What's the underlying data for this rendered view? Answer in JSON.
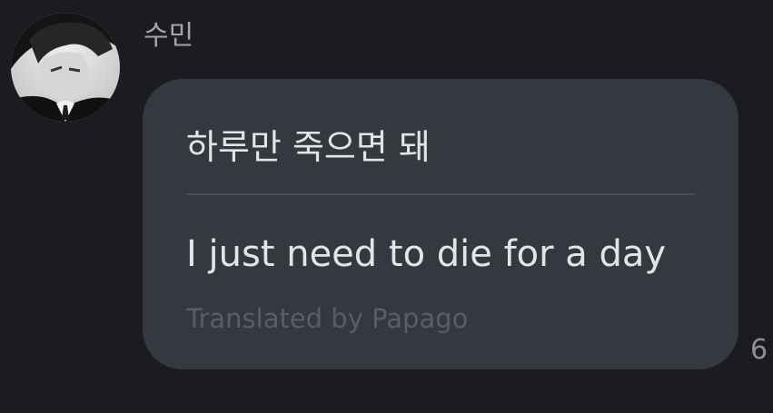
{
  "message": {
    "sender_name": "수민",
    "avatar": "profile-photo",
    "original_text": "하루만 죽으면 돼",
    "translated_text": "I just need to die for a day",
    "translation_credit": "Translated by Papago",
    "timestamp": "6"
  },
  "colors": {
    "background": "#1b1c20",
    "bubble": "#363840",
    "text_primary": "#e3e4e8",
    "text_secondary": "#a3a5ab",
    "text_muted": "#5b5d66",
    "divider": "#4a4c55"
  }
}
